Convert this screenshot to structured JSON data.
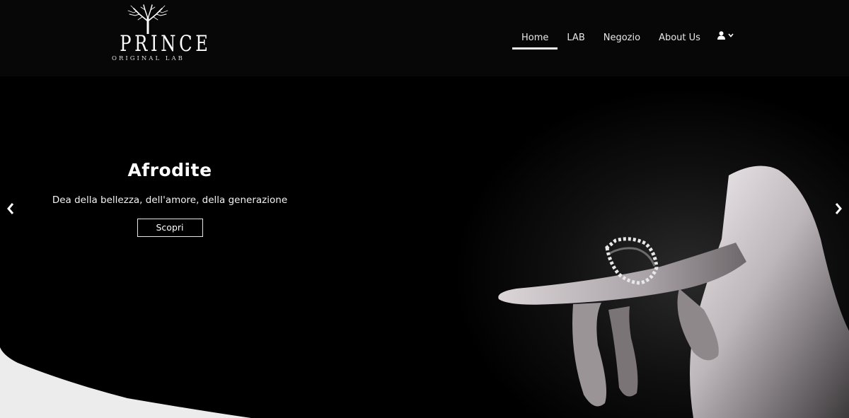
{
  "brand": {
    "logo_word": "PRINCE",
    "logo_subtitle": "ORIGINAL LAB",
    "logo_icon": "tree-icon"
  },
  "nav": {
    "items": [
      {
        "label": "Home",
        "active": true
      },
      {
        "label": "LAB",
        "active": false
      },
      {
        "label": "Negozio",
        "active": false
      },
      {
        "label": "About Us",
        "active": false
      }
    ],
    "user_icon": "user-icon",
    "dropdown_icon": "chevron-down-icon"
  },
  "hero": {
    "title": "Afrodite",
    "subtitle": "Dea della bellezza, dell'amore, della generazione",
    "cta_label": "Scopri",
    "prev_icon": "chevron-left-icon",
    "next_icon": "chevron-right-icon",
    "image": "hand-with-ring-photo"
  },
  "colors": {
    "background": "#000000",
    "header": "#070707",
    "text": "#ffffff",
    "wave": "#ececec"
  }
}
